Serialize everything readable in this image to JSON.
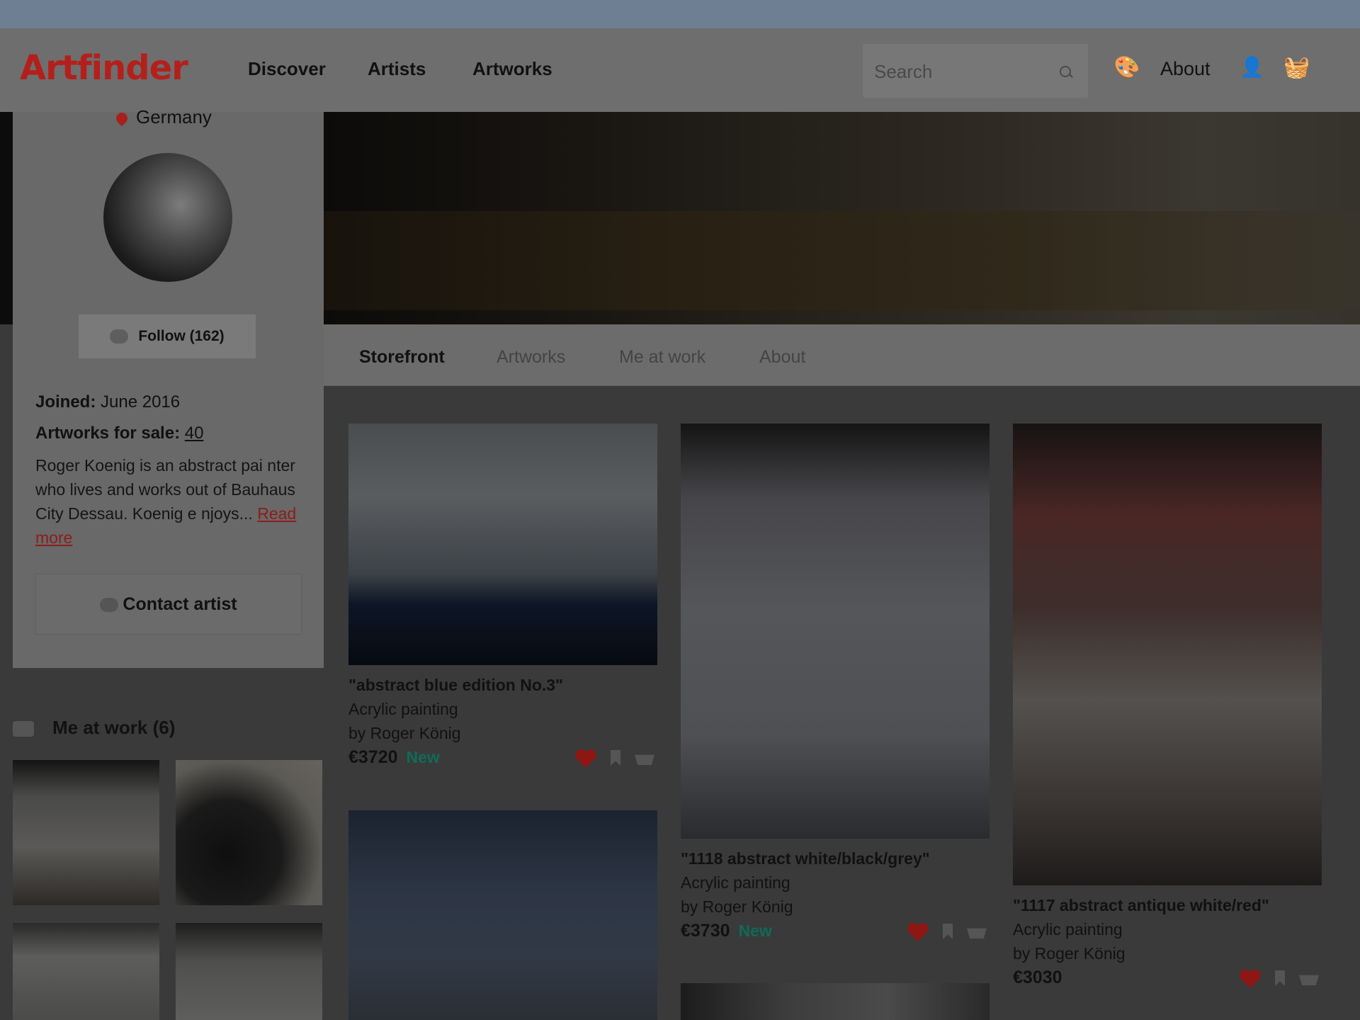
{
  "header": {
    "logo": "Artfinder",
    "nav": [
      "Discover",
      "Artists",
      "Artworks"
    ],
    "search_placeholder": "Search",
    "about": "About"
  },
  "profile": {
    "location": "Germany",
    "follow_label": "Follow (162)",
    "joined_label": "Joined:",
    "joined_value": "June 2016",
    "artworks_label": "Artworks for sale:",
    "artworks_value": "40",
    "bio": "Roger Koenig is an abstract pai nter who lives and works out of Bauhaus City Dessau. Koenig e njoys...",
    "read_more": "Read more",
    "contact": "Contact artist"
  },
  "me_at_work": {
    "title": "Me at work (6)"
  },
  "tabs": [
    "Storefront",
    "Artworks",
    "Me at work",
    "About"
  ],
  "artworks": [
    {
      "title": "\"abstract blue edition No.3\"",
      "medium": "Acrylic painting",
      "artist": "by Roger König",
      "price": "€3720",
      "badge": "New"
    },
    {
      "title": "\"1118 abstract white/black/grey\"",
      "medium": "Acrylic painting",
      "artist": "by Roger König",
      "price": "€3730",
      "badge": "New"
    },
    {
      "title": "\"1117 abstract antique white/red\"",
      "medium": "Acrylic painting",
      "artist": "by Roger König",
      "price": "€3030",
      "badge": ""
    }
  ],
  "colors": {
    "brand": "#b3201c",
    "new_badge": "#0f6b57",
    "heart": "#8f1713"
  }
}
